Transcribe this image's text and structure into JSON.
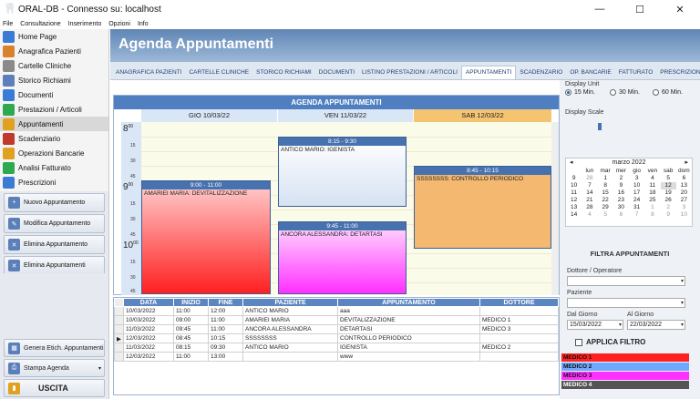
{
  "window": {
    "title": "ORAL-DB  -  Connesso su: localhost",
    "minimize": "—",
    "maximize": "☐",
    "close": "✕"
  },
  "menu": [
    "File",
    "Consultazione",
    "Inserimento",
    "Opzioni",
    "Info"
  ],
  "nav": {
    "items": [
      {
        "label": "Home Page",
        "icon": "home-icon",
        "color": "#3a7bd5"
      },
      {
        "label": "Anagrafica Pazienti",
        "icon": "patients-icon",
        "color": "#d9822b"
      },
      {
        "label": "Cartelle Cliniche",
        "icon": "folder-icon",
        "color": "#8a8a8a"
      },
      {
        "label": "Storico Richiami",
        "icon": "history-icon",
        "color": "#5b7fb8"
      },
      {
        "label": "Documenti",
        "icon": "documents-icon",
        "color": "#3a7bd5"
      },
      {
        "label": "Prestazioni / Articoli",
        "icon": "services-icon",
        "color": "#2fa84f"
      },
      {
        "label": "Appuntamenti",
        "icon": "appointments-icon",
        "color": "#e0a020"
      },
      {
        "label": "Scadenziario",
        "icon": "calendar-icon",
        "color": "#c0392b"
      },
      {
        "label": "Operazioni Bancarie",
        "icon": "bank-icon",
        "color": "#e0a020"
      },
      {
        "label": "Analisi Fatturato",
        "icon": "chart-icon",
        "color": "#2fa84f"
      },
      {
        "label": "Prescrizioni",
        "icon": "prescription-icon",
        "color": "#3a7bd5"
      }
    ],
    "active_index": 6
  },
  "actions": [
    "Nuovo Appuntamento",
    "Modifica Appuntamento",
    "Elimina Appuntamento",
    "Elimina Appuntamenti"
  ],
  "bottom": {
    "labels_btn": "Genera Etich. Appuntamenti",
    "print_btn": "Stampa Agenda",
    "exit_btn": "USCITA"
  },
  "page": {
    "title": "Agenda Appuntamenti"
  },
  "tabs": [
    "ANAGRAFICA PAZIENTI",
    "CARTELLE CLINICHE",
    "STORICO RICHIAMI",
    "DOCUMENTI",
    "LISTINO PRESTAZIONI / ARTICOLI",
    "APPUNTAMENTI",
    "SCADENZARIO",
    "OP. BANCARIE",
    "FATTURATO",
    "PRESCRIZIONI"
  ],
  "active_tab": 5,
  "calendar": {
    "header": "AGENDA APPUNTAMENTI",
    "days": [
      "GIO 10/03/22",
      "VEN 11/03/22",
      "SAB 12/03/22"
    ],
    "hours": [
      "8",
      "9",
      "10"
    ],
    "minute_marks": [
      "15",
      "30",
      "45"
    ],
    "appointments": [
      {
        "time": "9:00 - 11:00",
        "text": "AMARIEI MARIA: DEVITALIZZAZIONE",
        "color": "#ff4040"
      },
      {
        "time": "8:15 - 9:30",
        "text": "ANTICO MARIO: IGENISTA",
        "color": "#dfe8f6"
      },
      {
        "time": "9:45 - 11:00",
        "text": "ANCORA ALESSANDRA: DETARTASI",
        "color": "#ff50ff"
      },
      {
        "time": "8:45 - 10:15",
        "text": "SSSSSSSS: CONTROLLO PERIODICO",
        "color": "#f4b870"
      }
    ]
  },
  "table": {
    "columns": [
      "DATA",
      "INIZIO",
      "FINE",
      "PAZIENTE",
      "APPUNTAMENTO",
      "DOTTORE"
    ],
    "rows": [
      [
        "10/03/2022",
        "11:00",
        "12:00",
        "ANTICO MARIO",
        "aaa",
        ""
      ],
      [
        "10/03/2022",
        "09:00",
        "11:00",
        "AMARIEI MARIA",
        "DEVITALIZZAZIONE",
        "MEDICO 1"
      ],
      [
        "11/03/2022",
        "09:45",
        "11:00",
        "ANCORA ALESSANDRA",
        "DETARTASI",
        "MEDICO 3"
      ],
      [
        "12/03/2022",
        "08:45",
        "10:15",
        "SSSSSSSS",
        "CONTROLLO PERIODICO",
        ""
      ],
      [
        "11/03/2022",
        "08:15",
        "09:30",
        "ANTICO MARIO",
        "IGENISTA",
        "MEDICO 2"
      ],
      [
        "12/03/2022",
        "11:00",
        "13:00",
        "",
        "www",
        ""
      ]
    ],
    "current_row": 3,
    "current_marker": "▶"
  },
  "right": {
    "display_unit_label": "Display Unit",
    "units": [
      "15 Min.",
      "30 Min.",
      "60 Min."
    ],
    "selected_unit": 0,
    "display_scale_label": "Display Scale",
    "minical": {
      "prev": "◂",
      "next": "▸",
      "month": "marzo 2022",
      "weekdays": [
        "",
        "lun",
        "mar",
        "mer",
        "gio",
        "ven",
        "sab",
        "dom"
      ],
      "weeks": [
        [
          "9",
          "28",
          "1",
          "2",
          "3",
          "4",
          "5",
          "6"
        ],
        [
          "10",
          "7",
          "8",
          "9",
          "10",
          "11",
          "12",
          "13"
        ],
        [
          "11",
          "14",
          "15",
          "16",
          "17",
          "18",
          "19",
          "20"
        ],
        [
          "12",
          "21",
          "22",
          "23",
          "24",
          "25",
          "26",
          "27"
        ],
        [
          "13",
          "28",
          "29",
          "30",
          "31",
          "1",
          "2",
          "3"
        ],
        [
          "14",
          "4",
          "5",
          "6",
          "7",
          "8",
          "9",
          "10"
        ]
      ]
    },
    "filter_title": "FILTRA APPUNTAMENTI",
    "doctor_label": "Dottore / Operatore",
    "patient_label": "Paziente",
    "from_label": "Dal Giorno",
    "to_label": "Al Giorno",
    "from_value": "15/03/2022",
    "to_value": "22/03/2022",
    "apply_filter": "APPLICA FILTRO",
    "doctors": [
      {
        "name": "MEDICO 1",
        "color": "#ff2020"
      },
      {
        "name": "MEDICO 2",
        "color": "#6fa8ff"
      },
      {
        "name": "MEDICO 3",
        "color": "#ff30ff"
      },
      {
        "name": "MEDICO 4",
        "color": "#555555"
      }
    ]
  }
}
